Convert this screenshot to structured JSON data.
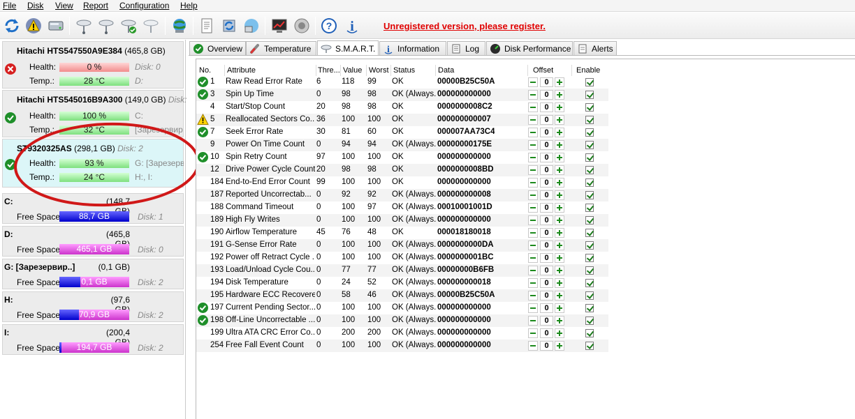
{
  "menu": [
    "File",
    "Disk",
    "View",
    "Report",
    "Configuration",
    "Help"
  ],
  "toolbar": {
    "register_text": "Unregistered version, please register."
  },
  "disks": [
    {
      "name": "Hitachi HTS547550A9E384",
      "capacity": "(465,8 GB)",
      "disk_label": "",
      "status": "error",
      "health_label": "Health:",
      "health": "0 %",
      "temp_label": "Temp.:",
      "temp": "28 °C",
      "right_health": "Disk: 0",
      "right_temp": "D:"
    },
    {
      "name": "Hitachi HTS545016B9A300",
      "capacity": "(149,0 GB)",
      "disk_label": "Disk:",
      "status": "ok",
      "health_label": "Health:",
      "health": "100 %",
      "temp_label": "Temp.:",
      "temp": "32 °C",
      "right_health": "C:",
      "right_temp": "[Зарезервир"
    },
    {
      "name": "ST9320325AS",
      "capacity": "(298,1 GB)",
      "disk_label": "Disk: 2",
      "status": "ok",
      "health_label": "Health:",
      "health": "93 %",
      "temp_label": "Temp.:",
      "temp": "24 °C",
      "right_health": "G: [Зарезерви",
      "right_temp": "H:, I:"
    }
  ],
  "volumes": [
    {
      "letter": "C:",
      "size": "(148,7 GB)",
      "free_label": "Free Space",
      "free": "88,7 GB",
      "used_fraction": 1.0,
      "disk": "Disk: 1"
    },
    {
      "letter": "D:",
      "size": "(465,8 GB)",
      "free_label": "Free Space",
      "free": "465,1 GB",
      "used_fraction": 0.0,
      "disk": "Disk: 0"
    },
    {
      "letter": "G: [Зарезервир..]",
      "size": "(0,1 GB)",
      "free_label": "Free Space",
      "free": "0,1 GB",
      "used_fraction": 0.3,
      "disk": "Disk: 2"
    },
    {
      "letter": "H:",
      "size": "(97,6 GB)",
      "free_label": "Free Space",
      "free": "70,9 GB",
      "used_fraction": 0.28,
      "disk": "Disk: 2"
    },
    {
      "letter": "I:",
      "size": "(200,4 GB)",
      "free_label": "Free Space",
      "free": "194,7 GB",
      "used_fraction": 0.03,
      "disk": "Disk: 2"
    }
  ],
  "tabs": [
    "Overview",
    "Temperature",
    "S.M.A.R.T.",
    "Information",
    "Log",
    "Disk Performance",
    "Alerts"
  ],
  "active_tab": "S.M.A.R.T.",
  "smart": {
    "headers": [
      "No.",
      "Attribute",
      "Thre...",
      "Value",
      "Worst",
      "Status",
      "Data",
      "Offset",
      "Enable"
    ],
    "rows": [
      {
        "no": "1",
        "attr": "Raw Read Error Rate",
        "thr": "6",
        "val": "118",
        "worst": "99",
        "status": "OK",
        "data": "00000B25C50A",
        "offset": "0",
        "icon": "ok"
      },
      {
        "no": "3",
        "attr": "Spin Up Time",
        "thr": "0",
        "val": "98",
        "worst": "98",
        "status": "OK (Always...",
        "data": "000000000000",
        "offset": "0",
        "icon": "ok"
      },
      {
        "no": "4",
        "attr": "Start/Stop Count",
        "thr": "20",
        "val": "98",
        "worst": "98",
        "status": "OK",
        "data": "0000000008C2",
        "offset": "0",
        "icon": ""
      },
      {
        "no": "5",
        "attr": "Reallocated Sectors Co...",
        "thr": "36",
        "val": "100",
        "worst": "100",
        "status": "OK",
        "data": "000000000007",
        "offset": "0",
        "icon": "warn"
      },
      {
        "no": "7",
        "attr": "Seek Error Rate",
        "thr": "30",
        "val": "81",
        "worst": "60",
        "status": "OK",
        "data": "000007AA73C4",
        "offset": "0",
        "icon": "ok"
      },
      {
        "no": "9",
        "attr": "Power On Time Count",
        "thr": "0",
        "val": "94",
        "worst": "94",
        "status": "OK (Always...",
        "data": "00000000175E",
        "offset": "0",
        "icon": ""
      },
      {
        "no": "10",
        "attr": "Spin Retry Count",
        "thr": "97",
        "val": "100",
        "worst": "100",
        "status": "OK",
        "data": "000000000000",
        "offset": "0",
        "icon": "ok"
      },
      {
        "no": "12",
        "attr": "Drive Power Cycle Count",
        "thr": "20",
        "val": "98",
        "worst": "98",
        "status": "OK",
        "data": "0000000008BD",
        "offset": "0",
        "icon": ""
      },
      {
        "no": "184",
        "attr": "End-to-End Error Count",
        "thr": "99",
        "val": "100",
        "worst": "100",
        "status": "OK",
        "data": "000000000000",
        "offset": "0",
        "icon": ""
      },
      {
        "no": "187",
        "attr": "Reported Uncorrectab...",
        "thr": "0",
        "val": "92",
        "worst": "92",
        "status": "OK (Always...",
        "data": "000000000008",
        "offset": "0",
        "icon": ""
      },
      {
        "no": "188",
        "attr": "Command Timeout",
        "thr": "0",
        "val": "100",
        "worst": "97",
        "status": "OK (Always...",
        "data": "00010001001D",
        "offset": "0",
        "icon": ""
      },
      {
        "no": "189",
        "attr": "High Fly Writes",
        "thr": "0",
        "val": "100",
        "worst": "100",
        "status": "OK (Always...",
        "data": "000000000000",
        "offset": "0",
        "icon": ""
      },
      {
        "no": "190",
        "attr": "Airflow Temperature",
        "thr": "45",
        "val": "76",
        "worst": "48",
        "status": "OK",
        "data": "000018180018",
        "offset": "0",
        "icon": ""
      },
      {
        "no": "191",
        "attr": "G-Sense Error Rate",
        "thr": "0",
        "val": "100",
        "worst": "100",
        "status": "OK (Always...",
        "data": "0000000000DA",
        "offset": "0",
        "icon": ""
      },
      {
        "no": "192",
        "attr": "Power off Retract Cycle ...",
        "thr": "0",
        "val": "100",
        "worst": "100",
        "status": "OK (Always...",
        "data": "0000000001BC",
        "offset": "0",
        "icon": ""
      },
      {
        "no": "193",
        "attr": "Load/Unload Cycle Cou...",
        "thr": "0",
        "val": "77",
        "worst": "77",
        "status": "OK (Always...",
        "data": "00000000B6FB",
        "offset": "0",
        "icon": ""
      },
      {
        "no": "194",
        "attr": "Disk Temperature",
        "thr": "0",
        "val": "24",
        "worst": "52",
        "status": "OK (Always...",
        "data": "000000000018",
        "offset": "0",
        "icon": ""
      },
      {
        "no": "195",
        "attr": "Hardware ECC Recovered",
        "thr": "0",
        "val": "58",
        "worst": "46",
        "status": "OK (Always...",
        "data": "00000B25C50A",
        "offset": "0",
        "icon": ""
      },
      {
        "no": "197",
        "attr": "Current Pending Sector...",
        "thr": "0",
        "val": "100",
        "worst": "100",
        "status": "OK (Always...",
        "data": "000000000000",
        "offset": "0",
        "icon": "ok"
      },
      {
        "no": "198",
        "attr": "Off-Line Uncorrectable ...",
        "thr": "0",
        "val": "100",
        "worst": "100",
        "status": "OK (Always...",
        "data": "000000000000",
        "offset": "0",
        "icon": "ok"
      },
      {
        "no": "199",
        "attr": "Ultra ATA CRC Error Co...",
        "thr": "0",
        "val": "200",
        "worst": "200",
        "status": "OK (Always...",
        "data": "000000000000",
        "offset": "0",
        "icon": ""
      },
      {
        "no": "254",
        "attr": "Free Fall Event Count",
        "thr": "0",
        "val": "100",
        "worst": "100",
        "status": "OK (Always...",
        "data": "000000000000",
        "offset": "0",
        "icon": ""
      }
    ]
  },
  "colors": {
    "register": "#e00000",
    "annotation": "#d01818",
    "ok_icon": "#1f8f2a",
    "error_icon": "#d62020"
  }
}
